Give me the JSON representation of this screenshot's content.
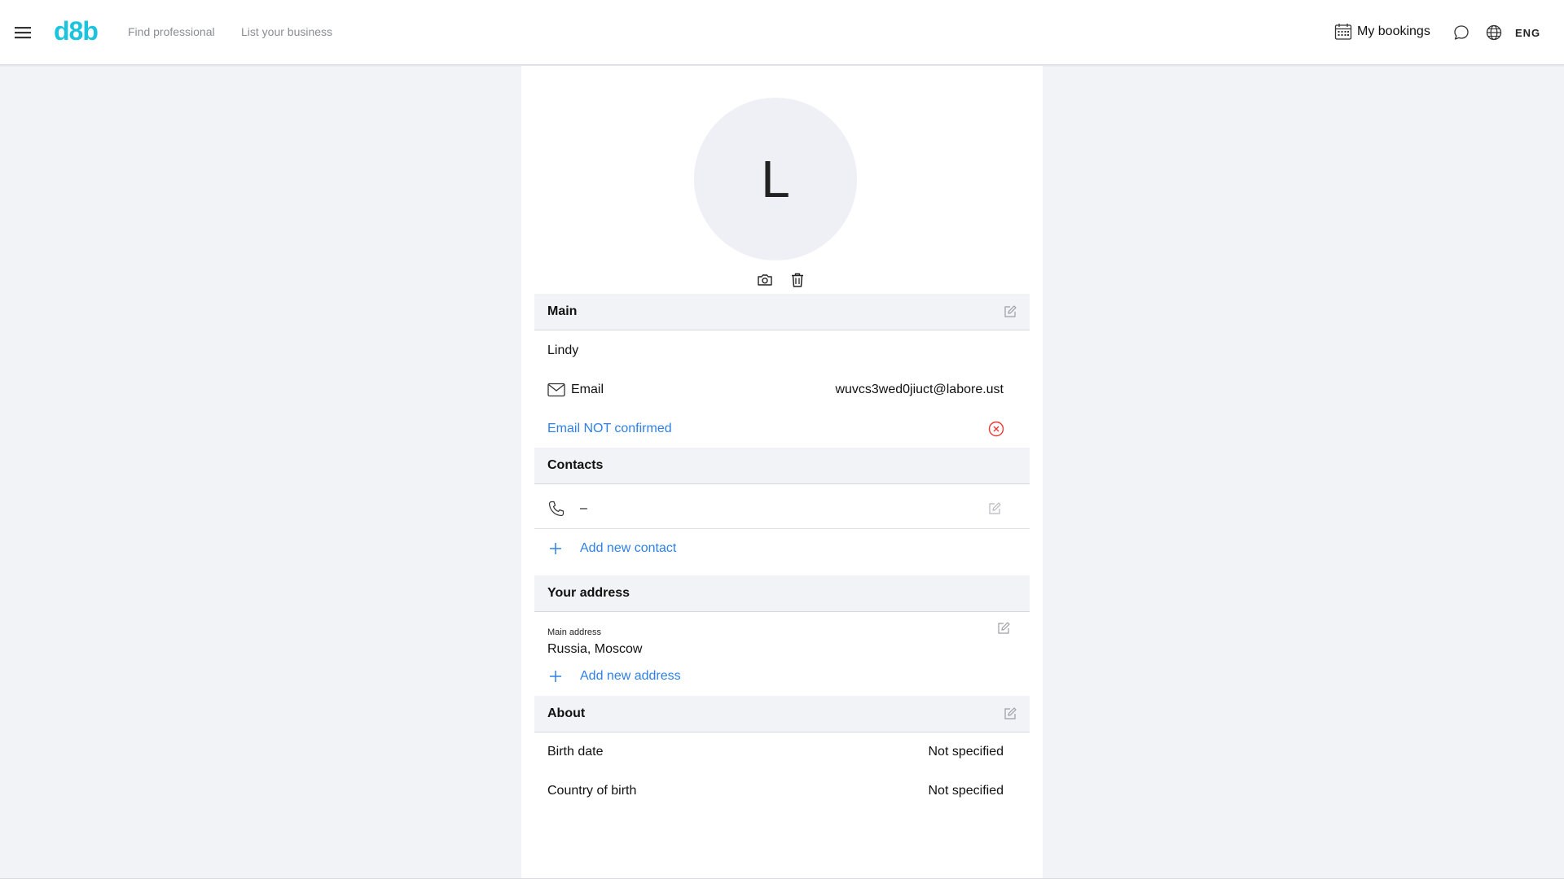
{
  "header": {
    "logo": "d8b",
    "logo_color": "#1bc3dd",
    "nav": [
      "Find professional",
      "List your business"
    ],
    "my_bookings": "My bookings",
    "language": "ENG"
  },
  "profile": {
    "avatar_initial": "L"
  },
  "main": {
    "title": "Main",
    "name": "Lindy",
    "email_label": "Email",
    "email_value": "wuvcs3wed0jiuct@labore.ust",
    "email_status": "Email NOT confirmed"
  },
  "contacts": {
    "title": "Contacts",
    "phone_value": "–",
    "add_label": "Add new contact"
  },
  "address": {
    "title": "Your address",
    "main_label": "Main address",
    "main_value": "Russia, Moscow",
    "add_label": "Add new address"
  },
  "about": {
    "title": "About",
    "birth_date_label": "Birth date",
    "birth_date_value": "Not specified",
    "country_label": "Country of birth",
    "country_value": "Not specified"
  },
  "colors": {
    "link": "#2f80e6",
    "error": "#e53935",
    "background": "#f2f3f7"
  }
}
